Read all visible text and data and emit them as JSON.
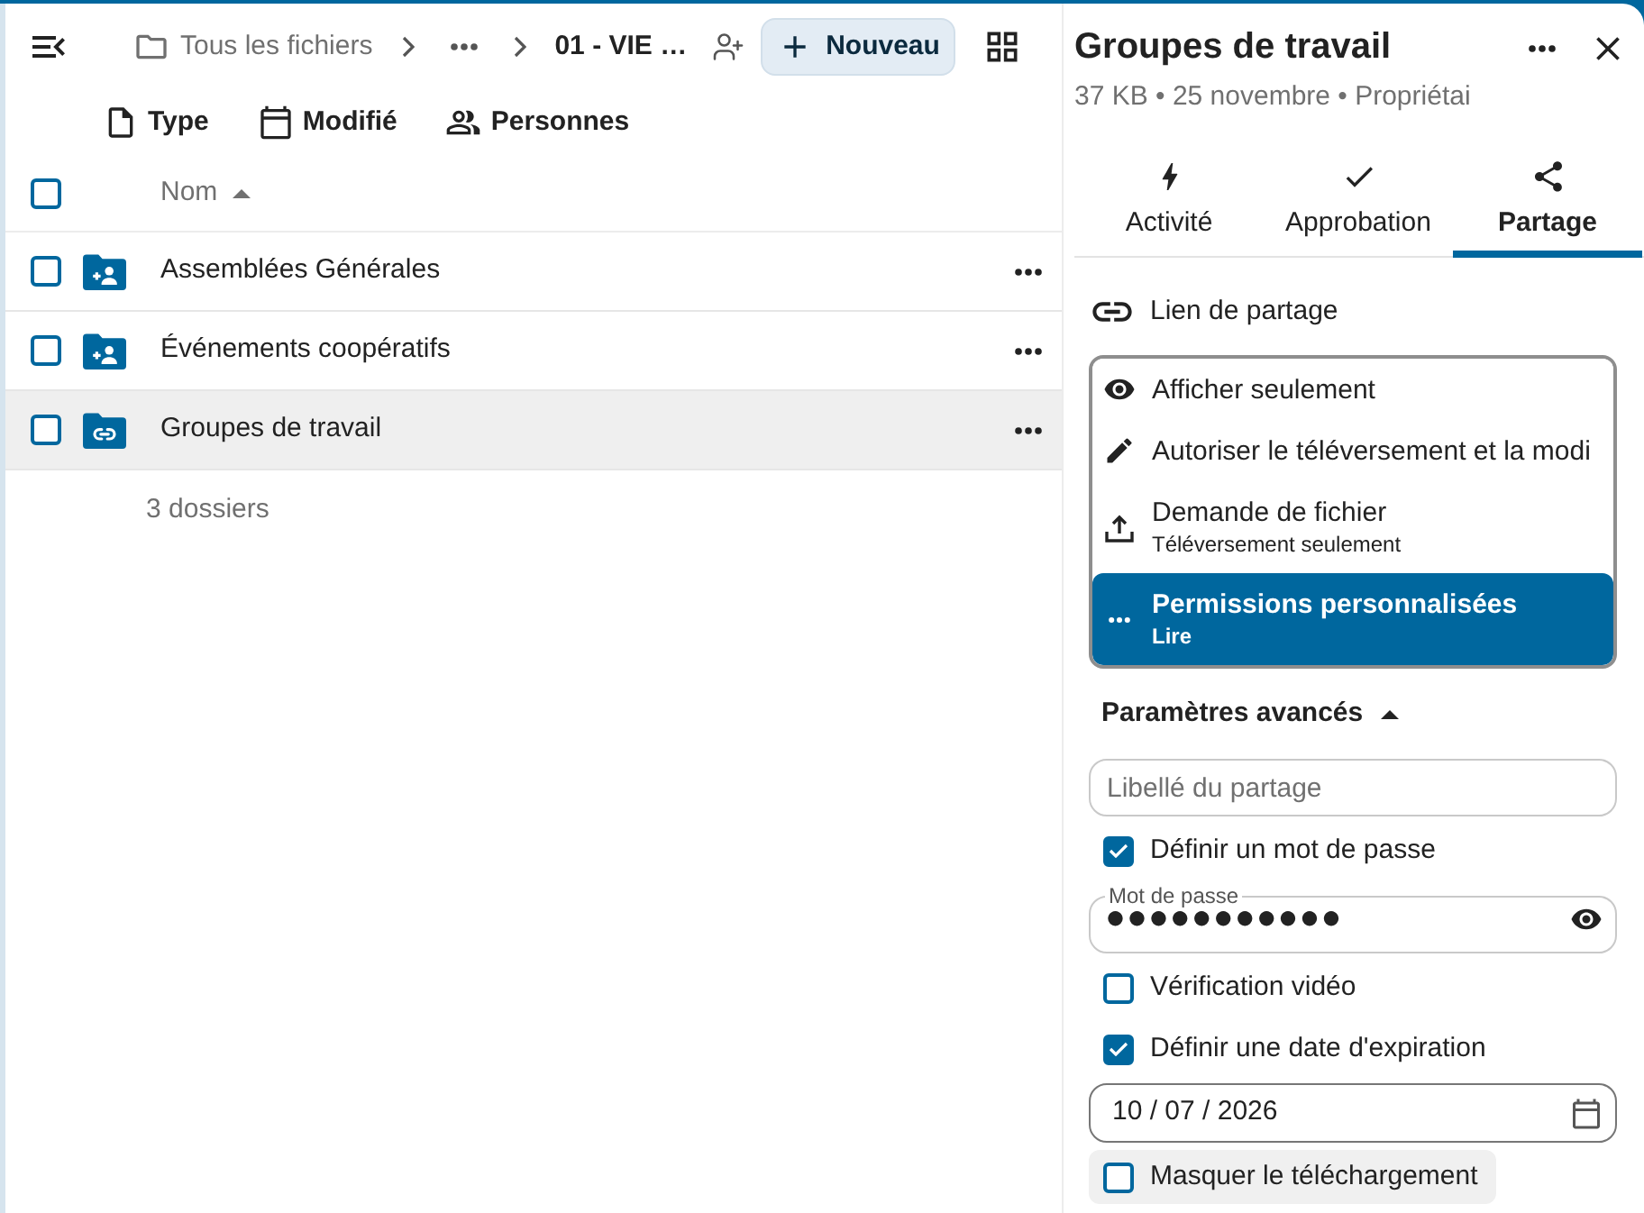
{
  "file_browser": {
    "breadcrumbs": [
      {
        "kind": "folder",
        "label": "Tous les fichiers"
      },
      {
        "kind": "collapsed"
      },
      {
        "kind": "current",
        "label": "01 - VIE …"
      }
    ],
    "new_button": "Nouveau",
    "filters": [
      {
        "kind": "type",
        "label": "Type"
      },
      {
        "kind": "modified",
        "label": "Modifié"
      },
      {
        "kind": "people",
        "label": "Personnes"
      }
    ],
    "select_all": {
      "checked": false
    },
    "columns": [
      {
        "label": "Nom",
        "ascending": true
      }
    ],
    "rows": [
      {
        "name": "Assemblées Générales",
        "kind": "shared",
        "checked": false,
        "selected": false
      },
      {
        "name": "Événements coopératifs",
        "kind": "shared",
        "checked": false,
        "selected": false
      },
      {
        "name": "Groupes de travail",
        "kind": "link",
        "checked": false,
        "selected": true
      }
    ],
    "summary": "3 dossiers"
  },
  "details": {
    "title": "Groupes de travail",
    "subtitle": "37 KB • 25 novembre • Propriétai",
    "tabs": [
      {
        "kind": "activity",
        "label": "Activité",
        "selected": false
      },
      {
        "kind": "approval",
        "label": "Approbation",
        "selected": false
      },
      {
        "kind": "sharing",
        "label": "Partage",
        "selected": true
      }
    ],
    "share_link": "Lien de partage",
    "permissions": [
      {
        "kind": "view",
        "label": "Afficher seulement",
        "selected": false
      },
      {
        "kind": "edit",
        "label": "Autoriser le téléversement et la modi",
        "selected": false
      },
      {
        "kind": "upload",
        "label": "Demande de fichier",
        "description": "Téléversement seulement",
        "selected": false
      },
      {
        "kind": "custom",
        "label": "Permissions personnalisées",
        "description": "Lire",
        "selected": true
      }
    ],
    "advanced": {
      "label": "Paramètres avancés",
      "expanded": true,
      "items": [
        {
          "kind": "text_field",
          "placeholder": "Libellé du partage"
        },
        {
          "kind": "checkbox",
          "label": "Définir un mot de passe",
          "checked": true,
          "highlighted": false
        },
        {
          "kind": "password_field",
          "label": "Mot de passe",
          "value": "●●●●●●●●●●●"
        },
        {
          "kind": "checkbox",
          "label": "Vérification vidéo",
          "checked": false,
          "highlighted": false
        },
        {
          "kind": "checkbox",
          "label": "Définir une date d'expiration",
          "checked": true,
          "highlighted": false
        },
        {
          "kind": "date_field",
          "value": "10 / 07 / 2026"
        },
        {
          "kind": "checkbox",
          "label": "Masquer le téléchargement",
          "checked": false,
          "highlighted": true
        }
      ]
    }
  }
}
